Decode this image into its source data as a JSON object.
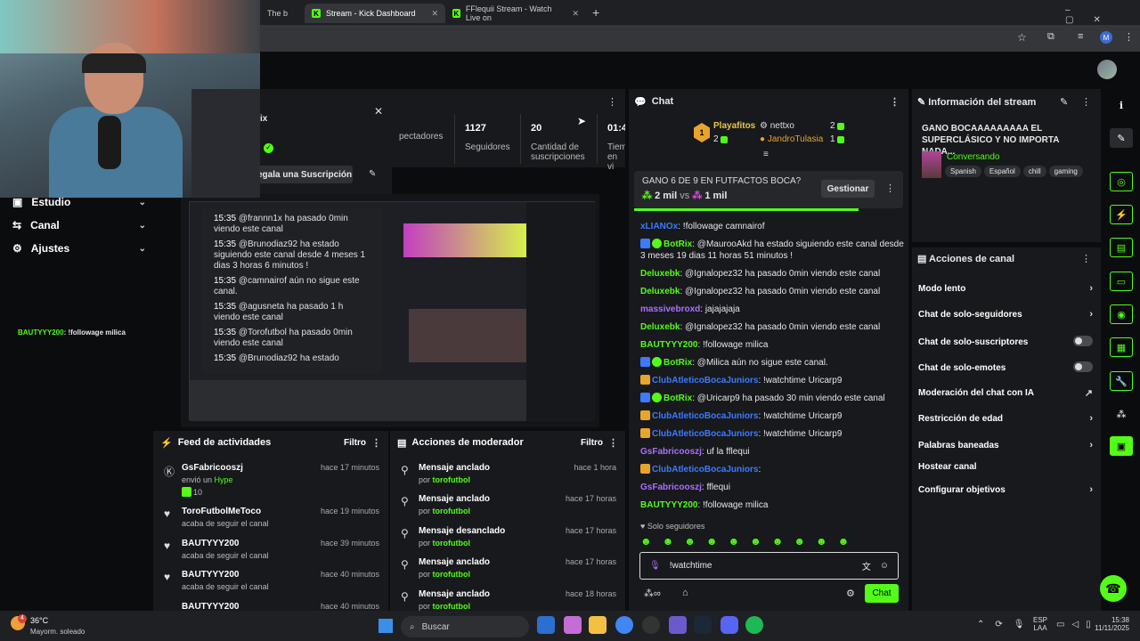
{
  "tabs": [
    {
      "label": "The b",
      "active": false
    },
    {
      "label": "Stream - Kick Dashboard",
      "active": true
    },
    {
      "label": "FFlequii Stream - Watch Live on",
      "active": false
    }
  ],
  "sidebar": {
    "items": [
      {
        "label": "Estudio"
      },
      {
        "label": "Canal"
      },
      {
        "label": "Ajustes"
      }
    ],
    "overlay_msg": {
      "user": "BAUTYYY200",
      "text": ": !followage milica"
    }
  },
  "popup": {
    "title_partial": "ix",
    "gift_label": "egala una Suscripción"
  },
  "commands": [
    {
      "time": "15:35",
      "text": "@frannn1x ha pasado 0min viendo este canal"
    },
    {
      "time": "15:35",
      "text": "@Brunodiaz92 ha estado siguiendo este canal desde 4 meses 1 dias 3 horas 6 minutos !"
    },
    {
      "time": "15:35",
      "text": "@camnairof aún no sigue este canal."
    },
    {
      "time": "15:35",
      "text": "@agusneta ha pasado 1 h viendo este canal"
    },
    {
      "time": "15:35",
      "text": "@Torofutbol ha pasado 0min viendo este canal"
    },
    {
      "time": "15:35",
      "text": "@Brunodiaz92 ha estado"
    }
  ],
  "stats": [
    {
      "value": "",
      "label": "pectadores"
    },
    {
      "value": "1127",
      "label": "Seguidores"
    },
    {
      "value": "20",
      "label": "Cantidad de suscripciones"
    },
    {
      "value": "01:4",
      "label": "Tiem en vi"
    }
  ],
  "feed": {
    "title": "Feed de actividades",
    "filter": "Filtro",
    "items": [
      {
        "name": "GsFabricooszj",
        "sub": "envió un",
        "hype": "Hype",
        "amount": "10",
        "time": "hace 17 minutos"
      },
      {
        "name": "ToroFutbolMeToco",
        "sub": "acaba de seguir el canal",
        "time": "hace 19 minutos"
      },
      {
        "name": "BAUTYYY200",
        "sub": "acaba de seguir el canal",
        "time": "hace 39 minutos"
      },
      {
        "name": "BAUTYYY200",
        "sub": "acaba de seguir el canal",
        "time": "hace 40 minutos"
      },
      {
        "name": "BAUTYYY200",
        "sub": "",
        "time": "hace 40 minutos"
      }
    ]
  },
  "mod": {
    "title": "Acciones de moderador",
    "filter": "Filtro",
    "items": [
      {
        "action": "Mensaje anclado",
        "by": "por",
        "who": "torofutbol",
        "time": "hace 1 hora"
      },
      {
        "action": "Mensaje anclado",
        "by": "por",
        "who": "torofutbol",
        "time": "hace 17 horas"
      },
      {
        "action": "Mensaje desanclado",
        "by": "por",
        "who": "torofutbol",
        "time": "hace 17 horas"
      },
      {
        "action": "Mensaje anclado",
        "by": "por",
        "who": "torofutbol",
        "time": "hace 17 horas"
      },
      {
        "action": "Mensaje anclado",
        "by": "por",
        "who": "torofutbol",
        "time": "hace 18 horas"
      }
    ]
  },
  "chat": {
    "title": "Chat",
    "leaders": [
      {
        "name": "Playafitos",
        "count": "2"
      },
      {
        "name": "nettxo",
        "count": "2"
      },
      {
        "name": "JandroTulasia",
        "count": "1"
      }
    ],
    "poll": {
      "title": "GANO 6 DE 9 EN FUTFACTOS BOCA?",
      "left": "2 mil",
      "vs": "vs",
      "right": "1 mil",
      "manage": "Gestionar"
    },
    "messages": [
      {
        "user": "xLIANOx",
        "color": "b",
        "text": ": !followage camnairof"
      },
      {
        "user": "BotRix",
        "color": "g",
        "text": ": @MaurooAkd ha estado siguiendo este canal desde 3 meses 19 dias 11 horas 51 minutos !"
      },
      {
        "user": "Deluxebk",
        "color": "g",
        "text": ": @Ignalopez32 ha pasado 0min viendo este canal"
      },
      {
        "user": "Deluxebk",
        "color": "g",
        "text": ": @Ignalopez32 ha pasado 0min viendo este canal"
      },
      {
        "user": "massivebroxd",
        "color": "p",
        "text": ": jajajajaja"
      },
      {
        "user": "Deluxebk",
        "color": "g",
        "text": ": @Ignalopez32 ha pasado 0min viendo este canal"
      },
      {
        "user": "BAUTYYY200",
        "color": "g",
        "text": ": !followage milica"
      },
      {
        "user": "BotRix",
        "color": "g",
        "text": ": @Milica aún no sigue este canal."
      },
      {
        "user": "ClubAtleticoBocaJuniors",
        "color": "b",
        "text": ": !watchtime Uricarp9"
      },
      {
        "user": "BotRix",
        "color": "g",
        "text": ": @Uricarp9 ha pasado 30 min viendo este canal"
      },
      {
        "user": "ClubAtleticoBocaJuniors",
        "color": "b",
        "text": ": !watchtime Uricarp9"
      },
      {
        "user": "ClubAtleticoBocaJuniors",
        "color": "b",
        "text": ": !watchtime Uricarp9"
      },
      {
        "user": "GsFabricooszj",
        "color": "p",
        "text": ": uf la fflequi"
      },
      {
        "user": "ClubAtleticoBocaJuniors",
        "color": "b",
        "text": ":"
      },
      {
        "user": "GsFabricooszj",
        "color": "p",
        "text": ": fflequi"
      },
      {
        "user": "BAUTYYY200",
        "color": "g",
        "text": ": !followage milica"
      }
    ],
    "mode_label": "Solo seguidores",
    "input_value": "!watchtime",
    "send_label": "Chat"
  },
  "info": {
    "title": "Información del stream",
    "stream_title": "GANO BOCAAAAAAAAA EL SUPERCLÁSICO Y NO IMPORTA NADA...",
    "category": "Conversando",
    "tags": [
      "Spanish",
      "Español",
      "chill",
      "gaming"
    ]
  },
  "actions": {
    "title": "Acciones de canal",
    "rows": [
      {
        "label": "Modo lento",
        "kind": "chev"
      },
      {
        "label": "Chat de solo-seguidores",
        "kind": "chev"
      },
      {
        "label": "Chat de solo-suscriptores",
        "kind": "toggle"
      },
      {
        "label": "Chat de solo-emotes",
        "kind": "toggle"
      },
      {
        "label": "Moderación del chat con IA",
        "kind": "ext"
      },
      {
        "label": "Restricción de edad",
        "kind": "chev"
      },
      {
        "label": "Palabras baneadas",
        "kind": "chev"
      },
      {
        "label": "Hostear canal",
        "kind": "none"
      },
      {
        "label": "Configurar objetivos",
        "kind": "chev"
      }
    ]
  },
  "taskbar": {
    "weather_temp": "36°C",
    "weather_desc": "Mayorm. soleado",
    "search": "Buscar",
    "lang": "ESP",
    "lang2": "LAA",
    "time": "15:38",
    "date": "11/11/2025",
    "badge": "4"
  },
  "colors": {
    "accent": "#53fc18",
    "panel": "#18191c",
    "bg": "#0b0c0e"
  }
}
